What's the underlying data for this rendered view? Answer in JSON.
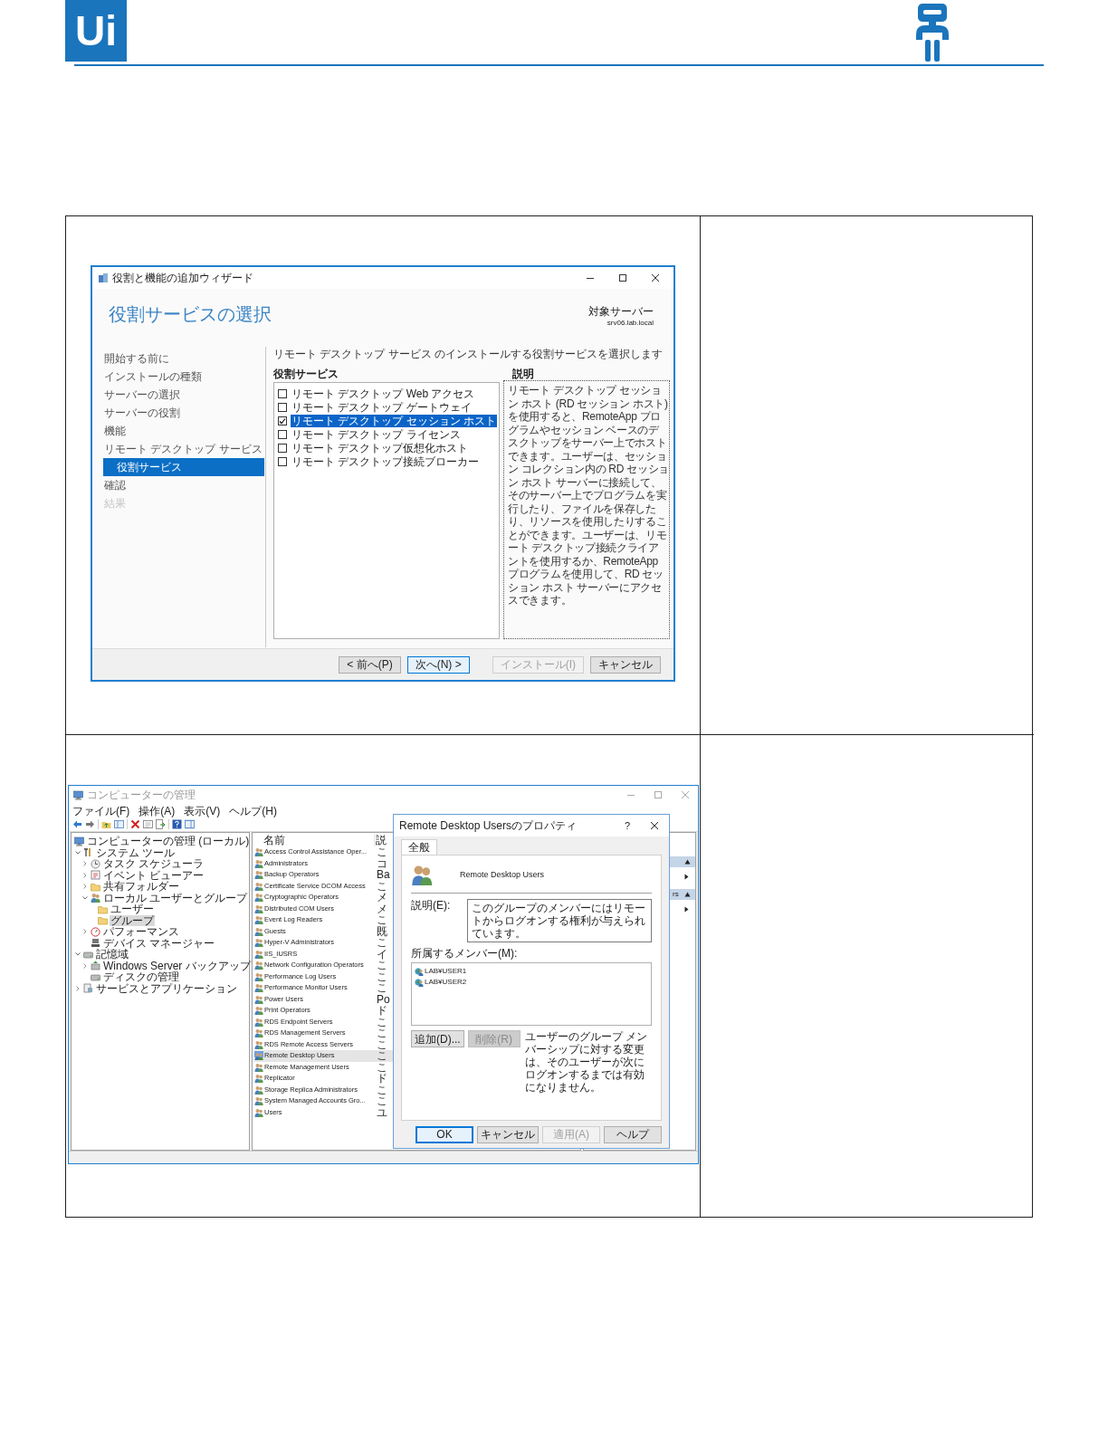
{
  "header": {
    "logo": "Ui"
  },
  "wizard_window": {
    "title": "役割と機能の追加ウィザード",
    "heading": "役割サービスの選択",
    "target_server_label": "対象サーバー",
    "target_server": "srv06.lab.local",
    "nav": [
      {
        "label": "開始する前に",
        "selected": false,
        "disabled": false
      },
      {
        "label": "インストールの種類",
        "selected": false,
        "disabled": false
      },
      {
        "label": "サーバーの選択",
        "selected": false,
        "disabled": false
      },
      {
        "label": "サーバーの役割",
        "selected": false,
        "disabled": false
      },
      {
        "label": "機能",
        "selected": false,
        "disabled": false
      },
      {
        "label": "リモート デスクトップ サービス",
        "selected": false,
        "disabled": false,
        "children": [
          {
            "label": "役割サービス",
            "selected": true,
            "disabled": false
          }
        ]
      },
      {
        "label": "確認",
        "selected": false,
        "disabled": false
      },
      {
        "label": "結果",
        "selected": false,
        "disabled": true
      }
    ],
    "instruction": "リモート デスクトップ サービス のインストールする役割サービスを選択します",
    "services_heading": "役割サービス",
    "services": [
      {
        "label": "リモート デスクトップ Web アクセス",
        "checked": false,
        "selected": false
      },
      {
        "label": "リモート デスクトップ ゲートウェイ",
        "checked": false,
        "selected": false
      },
      {
        "label": "リモート デスクトップ セッション ホスト",
        "checked": true,
        "selected": true
      },
      {
        "label": "リモート デスクトップ ライセンス",
        "checked": false,
        "selected": false
      },
      {
        "label": "リモート デスクトップ仮想化ホスト",
        "checked": false,
        "selected": false
      },
      {
        "label": "リモート デスクトップ接続ブローカー",
        "checked": false,
        "selected": false
      }
    ],
    "description_heading": "説明",
    "description": "リモート デスクトップ セッション ホスト (RD セッション ホスト) を使用すると、RemoteApp プログラムやセッション ベースのデスクトップをサーバー上でホストできます。ユーザーは、セッション コレクション内の RD セッション ホスト サーバーに接続して、そのサーバー上でプログラムを実行したり、ファイルを保存したり、リソースを使用したりすることができます。ユーザーは、リモート デスクトップ接続クライアントを使用するか、RemoteApp プログラムを使用して、RD セッション ホスト サーバーにアクセスできます。",
    "buttons": [
      {
        "label": "< 前へ(P)",
        "default": false,
        "disabled": false
      },
      {
        "label": "次へ(N) >",
        "default": true,
        "disabled": false
      },
      {
        "label": "インストール(I)",
        "default": false,
        "disabled": true
      },
      {
        "label": "キャンセル",
        "default": false,
        "disabled": false
      }
    ]
  },
  "management_window": {
    "title": "コンピューターの管理",
    "menu": [
      "ファイル(F)",
      "操作(A)",
      "表示(V)",
      "ヘルプ(H)"
    ],
    "tree": [
      {
        "label": "コンピューターの管理 (ローカル)",
        "expandable": false,
        "selected": false,
        "children": [
          {
            "label": "システム ツール",
            "expandable": true,
            "expanded": true,
            "selected": false,
            "children": [
              {
                "label": "タスク スケジューラ",
                "expandable": true,
                "expanded": false,
                "selected": false
              },
              {
                "label": "イベント ビューアー",
                "expandable": true,
                "expanded": false,
                "selected": false
              },
              {
                "label": "共有フォルダー",
                "expandable": true,
                "expanded": false,
                "selected": false
              },
              {
                "label": "ローカル ユーザーとグループ",
                "expandable": true,
                "expanded": true,
                "selected": false,
                "children": [
                  {
                    "label": "ユーザー",
                    "expandable": false,
                    "selected": false
                  },
                  {
                    "label": "グループ",
                    "expandable": false,
                    "selected": true
                  }
                ]
              },
              {
                "label": "パフォーマンス",
                "expandable": true,
                "expanded": false,
                "selected": false
              },
              {
                "label": "デバイス マネージャー",
                "expandable": false,
                "selected": false
              }
            ]
          },
          {
            "label": "記憶域",
            "expandable": true,
            "expanded": true,
            "selected": false,
            "children": [
              {
                "label": "Windows Server バックアップ",
                "expandable": true,
                "expanded": false,
                "selected": false
              },
              {
                "label": "ディスクの管理",
                "expandable": false,
                "selected": false
              }
            ]
          },
          {
            "label": "サービスとアプリケーション",
            "expandable": true,
            "expanded": false,
            "selected": false
          }
        ]
      }
    ],
    "list": {
      "columns": [
        "名前",
        "説"
      ],
      "rows": [
        {
          "name": "Access Control Assistance Oper...",
          "description": "こ",
          "selected": false
        },
        {
          "name": "Administrators",
          "description": "コ",
          "selected": false
        },
        {
          "name": "Backup Operators",
          "description": "Ba",
          "selected": false
        },
        {
          "name": "Certificate Service DCOM Access",
          "description": "こ",
          "selected": false
        },
        {
          "name": "Cryptographic Operators",
          "description": "メ",
          "selected": false
        },
        {
          "name": "Distributed COM Users",
          "description": "メ",
          "selected": false
        },
        {
          "name": "Event Log Readers",
          "description": "こ",
          "selected": false
        },
        {
          "name": "Guests",
          "description": "既",
          "selected": false
        },
        {
          "name": "Hyper-V Administrators",
          "description": "こ",
          "selected": false
        },
        {
          "name": "IIS_IUSRS",
          "description": "イ",
          "selected": false
        },
        {
          "name": "Network Configuration Operators",
          "description": "こ",
          "selected": false
        },
        {
          "name": "Performance Log Users",
          "description": "こ",
          "selected": false
        },
        {
          "name": "Performance Monitor Users",
          "description": "こ",
          "selected": false
        },
        {
          "name": "Power Users",
          "description": "Po",
          "selected": false
        },
        {
          "name": "Print Operators",
          "description": "ド",
          "selected": false
        },
        {
          "name": "RDS Endpoint Servers",
          "description": "こ",
          "selected": false
        },
        {
          "name": "RDS Management Servers",
          "description": "こ",
          "selected": false
        },
        {
          "name": "RDS Remote Access Servers",
          "description": "こ",
          "selected": false
        },
        {
          "name": "Remote Desktop Users",
          "description": "こ",
          "selected": true
        },
        {
          "name": "Remote Management Users",
          "description": "こ",
          "selected": false
        },
        {
          "name": "Replicator",
          "description": "ド",
          "selected": false
        },
        {
          "name": "Storage Replica Administrators",
          "description": "こ",
          "selected": false
        },
        {
          "name": "System Managed Accounts Gro...",
          "description": "こ",
          "selected": false
        },
        {
          "name": "Users",
          "description": "ユ",
          "selected": false
        }
      ]
    },
    "actions_pane": {
      "sections": [
        {
          "expanded": true
        },
        {
          "label": "rs",
          "expanded": true
        }
      ]
    },
    "dialog": {
      "title": "Remote Desktop Usersのプロパティ",
      "help_button": "?",
      "tabs": [
        {
          "label": "全般",
          "selected": true
        }
      ],
      "group_name": "Remote Desktop Users",
      "description_label": "説明(E):",
      "description": "このグループのメンバーにはリモートからログオンする権利が与えられています。",
      "members_label": "所属するメンバー(M):",
      "members": [
        "LAB¥USER1",
        "LAB¥USER2"
      ],
      "member_buttons": [
        {
          "label": "追加(D)...",
          "disabled": false
        },
        {
          "label": "削除(R)",
          "disabled": true
        }
      ],
      "note": "ユーザーのグループ メンバーシップに対する変更は、そのユーザーが次にログオンするまでは有効になりません。",
      "buttons": [
        {
          "label": "OK",
          "default": true,
          "disabled": false
        },
        {
          "label": "キャンセル",
          "default": false,
          "disabled": false
        },
        {
          "label": "適用(A)",
          "default": false,
          "disabled": true
        },
        {
          "label": "ヘルプ",
          "default": false,
          "disabled": false
        }
      ]
    }
  }
}
